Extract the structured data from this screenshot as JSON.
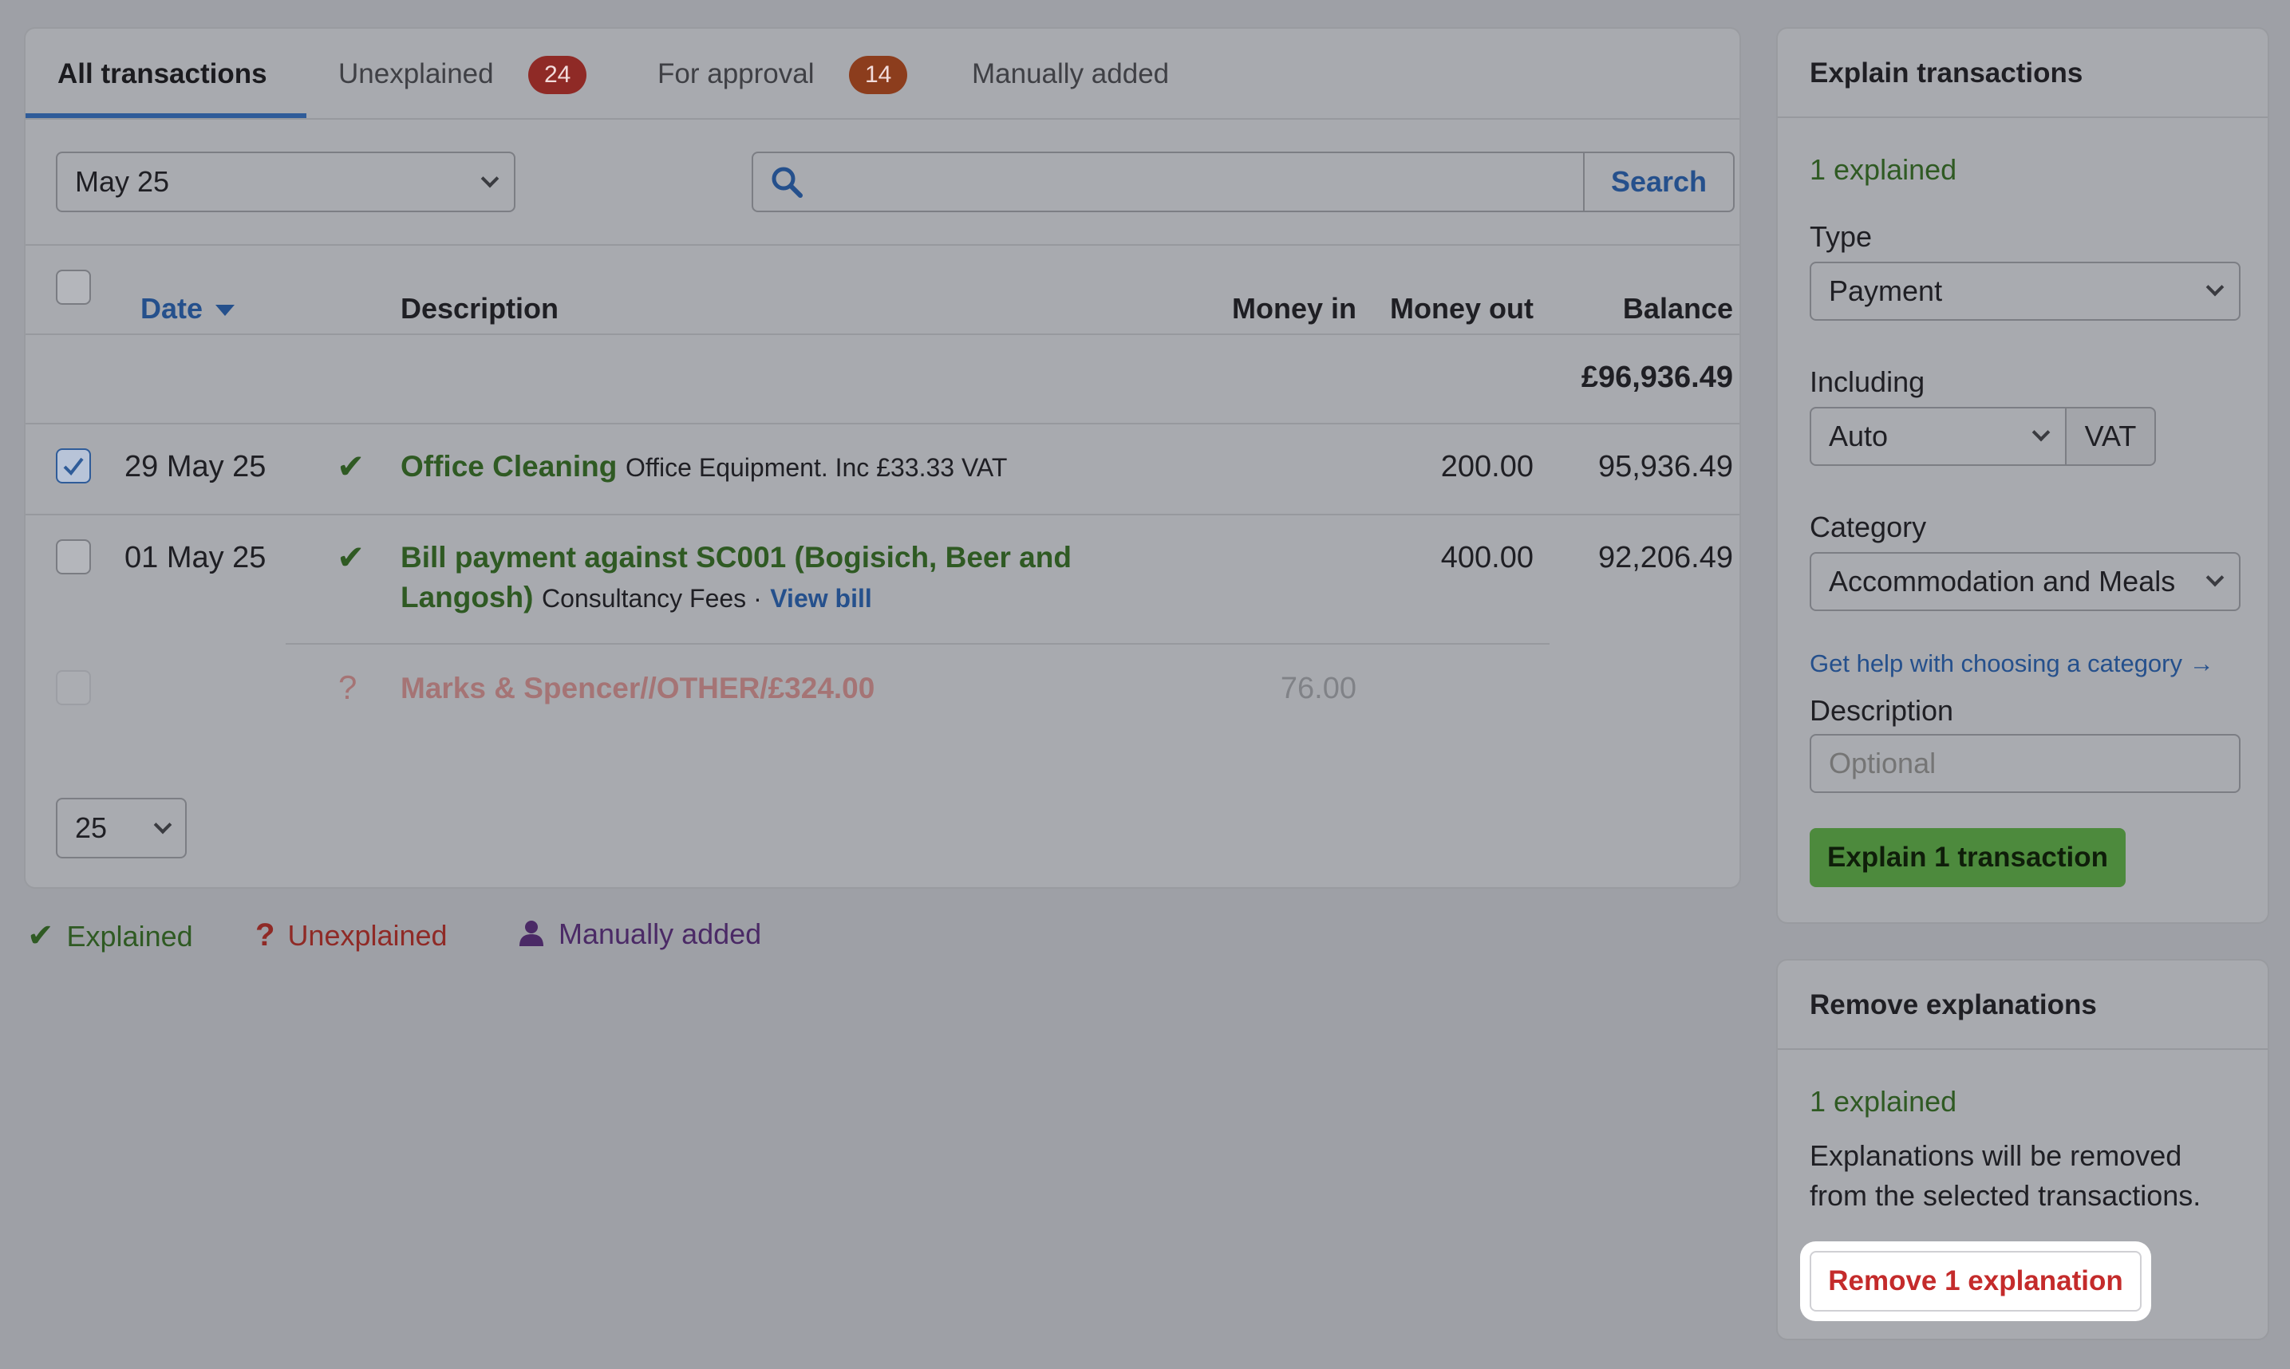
{
  "tabs": [
    {
      "label": "All transactions",
      "active": true
    },
    {
      "label": "Unexplained",
      "badge": "24"
    },
    {
      "label": "For approval",
      "badge": "14"
    },
    {
      "label": "Manually added"
    }
  ],
  "filters": {
    "month": "May 25",
    "search_placeholder": "",
    "search_button": "Search"
  },
  "table": {
    "columns": {
      "date": "Date",
      "description": "Description",
      "money_in": "Money in",
      "money_out": "Money out",
      "balance": "Balance"
    },
    "opening_balance": "£96,936.49",
    "rows": [
      {
        "checked": true,
        "date": "29 May 25",
        "status_icon": "check-icon",
        "title": "Office Cleaning",
        "detail": "Office Equipment. Inc £33.33 VAT",
        "money_in": "",
        "money_out": "200.00",
        "balance": "95,936.49"
      },
      {
        "checked": false,
        "date": "01 May 25",
        "status_icon": "check-icon",
        "title_line1": "Bill payment against SC001 (Bogisich, Beer and",
        "title_line2": "Langosh)",
        "detail": "Consultancy Fees ·",
        "link": "View bill",
        "money_out": "400.00",
        "balance": "92,206.49"
      },
      {
        "checked": false,
        "disabled": true,
        "status_icon": "question-icon",
        "status_symbol": "?",
        "title": "Marks & Spencer//OTHER/£324.00",
        "money_in": "76.00"
      }
    ],
    "page_size": "25"
  },
  "legend": {
    "explained": "Explained",
    "unexplained": "Unexplained",
    "manual": "Manually added"
  },
  "explain_panel": {
    "title": "Explain transactions",
    "count": "1 explained",
    "type_label": "Type",
    "type_value": "Payment",
    "including_label": "Including",
    "including_value": "Auto",
    "vat_label": "VAT",
    "category_label": "Category",
    "category_value": "Accommodation and Meals",
    "help_link": "Get help with choosing a category →",
    "description_label": "Description",
    "description_placeholder": "Optional",
    "submit": "Explain 1 transaction"
  },
  "remove_panel": {
    "title": "Remove explanations",
    "count": "1 explained",
    "message_line1": "Explanations will be removed",
    "message_line2": "from the selected transactions.",
    "button": "Remove 1 explanation"
  },
  "colors": {
    "accent_blue": "#2f5c99",
    "explained_green": "#2f5a23",
    "unexplained_red": "#8f2a26",
    "manual_purple": "#4b2a66",
    "remove_red": "#c42b2b"
  }
}
